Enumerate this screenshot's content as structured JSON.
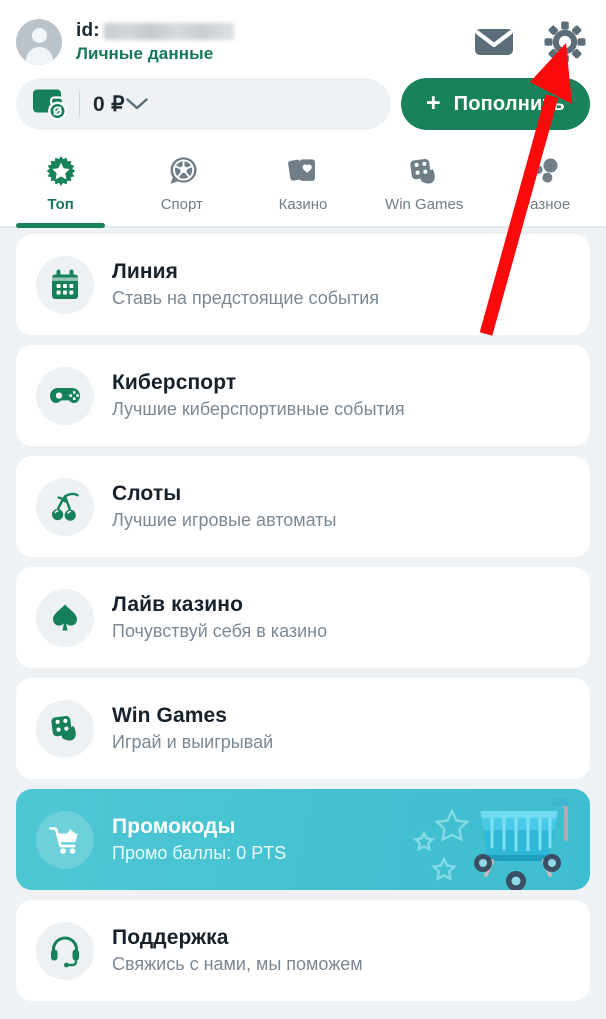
{
  "header": {
    "avatar_icon": "user-avatar-icon",
    "id_label": "id:",
    "id_value_redacted": "",
    "personal_data_link": "Личные данные",
    "mail_icon": "envelope-icon",
    "settings_icon": "gear-icon"
  },
  "balance": {
    "wallet_icon": "wallet-refresh-icon",
    "amount": "0 ₽",
    "dropdown_icon": "chevron-down-icon",
    "topup_plus": "+",
    "topup_label": "Пополнить"
  },
  "tabs": [
    {
      "label": "Топ",
      "icon": "star-badge-icon",
      "active": true
    },
    {
      "label": "Спорт",
      "icon": "soccer-ball-icon",
      "active": false
    },
    {
      "label": "Казино",
      "icon": "playing-cards-icon",
      "active": false
    },
    {
      "label": "Win Games",
      "icon": "dice-icon",
      "active": false
    },
    {
      "label": "Разное",
      "icon": "more-dots-icon",
      "active": false
    }
  ],
  "list": [
    {
      "title": "Линия",
      "subtitle": "Ставь на предстоящие события",
      "icon": "calendar-icon"
    },
    {
      "title": "Киберспорт",
      "subtitle": "Лучшие киберспортивные события",
      "icon": "gamepad-icon"
    },
    {
      "title": "Слоты",
      "subtitle": "Лучшие игровые автоматы",
      "icon": "cherries-icon"
    },
    {
      "title": "Лайв казино",
      "subtitle": "Почувствуй себя в казино",
      "icon": "spade-icon"
    },
    {
      "title": "Win Games",
      "subtitle": "Играй и выигрывай",
      "icon": "dice-icon"
    },
    {
      "title": "Промокоды",
      "subtitle": "Промо баллы: 0 PTS",
      "icon": "shopping-cart-icon",
      "highlight": true
    },
    {
      "title": "Поддержка",
      "subtitle": "Свяжись с нами, мы поможем",
      "icon": "headset-icon"
    }
  ],
  "annotation": {
    "type": "red-arrow",
    "points_to": "gear-icon"
  },
  "colors": {
    "brand_green": "#18825a",
    "link_green": "#157a54",
    "page_bg": "#eef2f5",
    "card_bg": "#ffffff",
    "promo_teal": "#47c3d2",
    "muted_text": "#7b8894",
    "icon_gray": "#6f7e87",
    "annotation_red": "#fa0a0a"
  }
}
